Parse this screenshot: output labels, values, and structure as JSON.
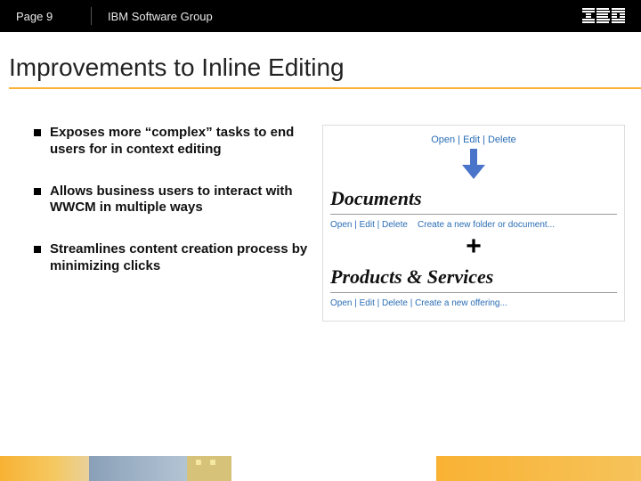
{
  "header": {
    "page_label": "Page 9",
    "group": "IBM Software Group",
    "logo_name": "ibm-logo"
  },
  "title": "Improvements to Inline Editing",
  "bullets": [
    "Exposes more “complex” tasks to end users for in context editing",
    "Allows business users to interact with WWCM in multiple ways",
    "Streamlines content creation process by minimizing clicks"
  ],
  "illustration": {
    "top_actions": "Open | Edit | Delete",
    "section1": {
      "heading": "Documents",
      "actions": "Open | Edit | Delete",
      "create": "Create a new folder or document..."
    },
    "plus": "+",
    "section2": {
      "heading": "Products & Services",
      "actions": "Open | Edit | Delete | Create a new offering..."
    }
  }
}
